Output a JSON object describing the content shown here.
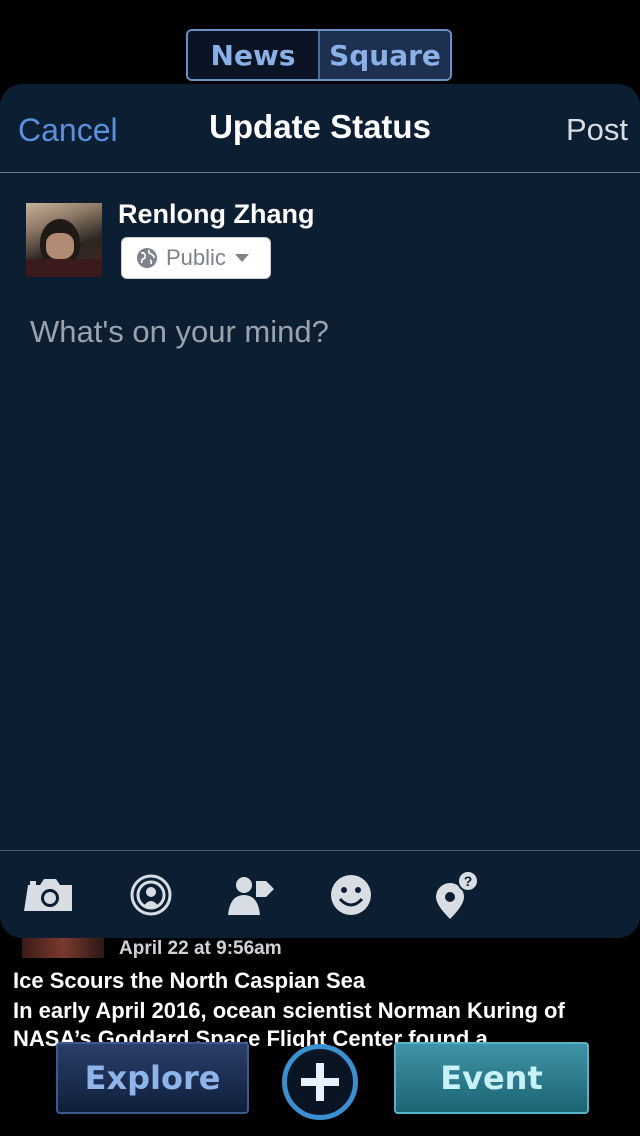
{
  "segments": {
    "news": "News",
    "square": "Square"
  },
  "nav": {
    "cancel": "Cancel",
    "title": "Update Status",
    "post": "Post"
  },
  "user": {
    "name": "Renlong Zhang",
    "privacy": "Public"
  },
  "composer": {
    "placeholder": "What's on your mind?"
  },
  "toolbar": {
    "icons": [
      "camera-icon",
      "live-broadcast-icon",
      "tag-friends-icon",
      "emoji-icon",
      "check-in-icon"
    ]
  },
  "feed": {
    "date": "April 22 at 9:56am",
    "title": "Ice Scours the North Caspian Sea",
    "body": "In early April 2016, ocean scientist Norman Kuring of NASA’s Goddard Space Flight Center found a"
  },
  "bottom": {
    "explore": "Explore",
    "event": "Event"
  },
  "colors": {
    "accent": "#5b8fe0",
    "sheet": "#0b1e32",
    "event": "#2a8294"
  }
}
